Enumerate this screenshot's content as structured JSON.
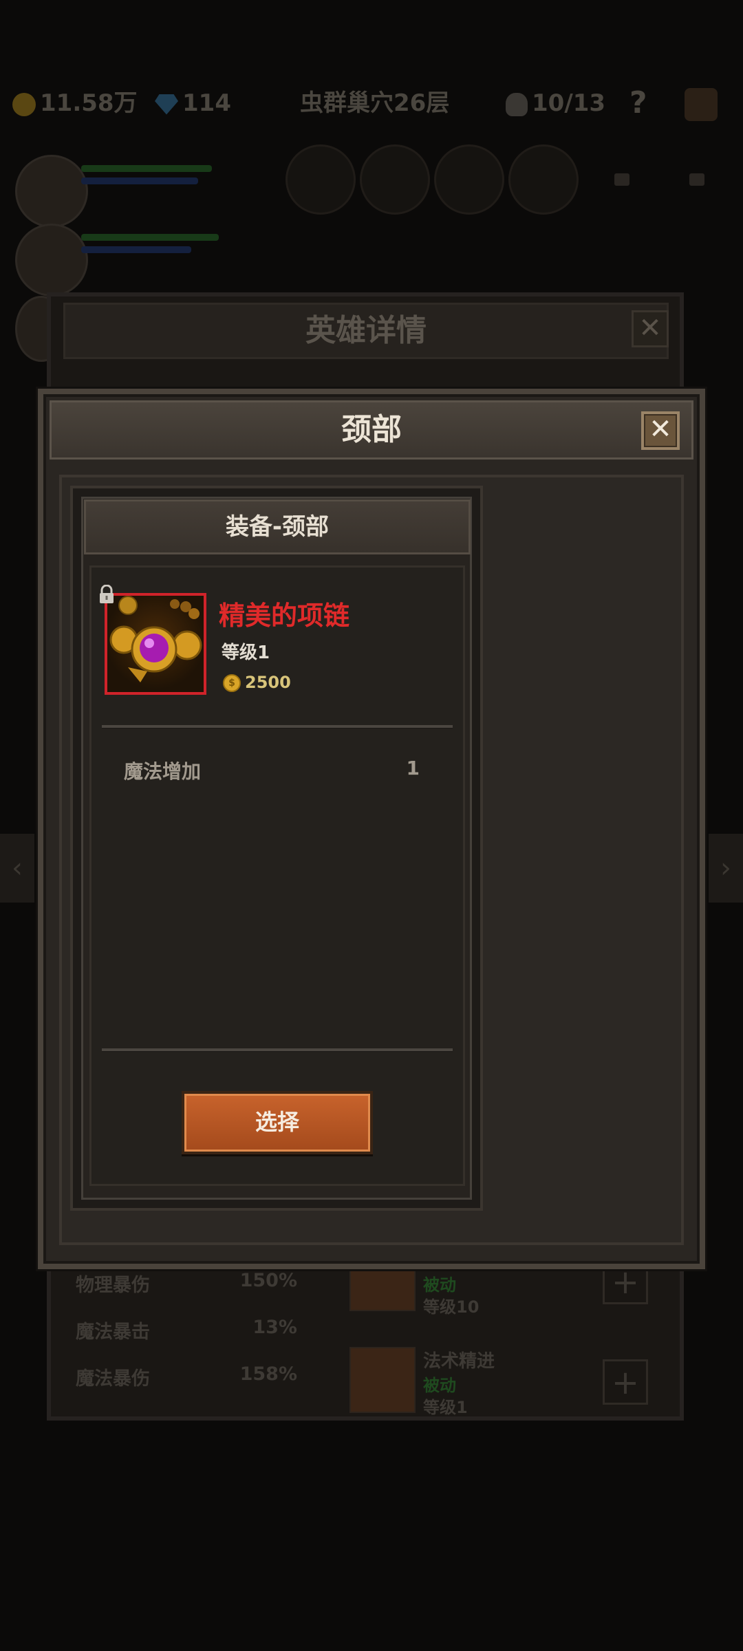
{
  "background": {
    "top_bar": {
      "gold": "11.58万",
      "gems": "114",
      "location": "虫群巢穴26层",
      "skull_count": "10/13",
      "help": "?"
    },
    "hero_details_panel": {
      "title": "英雄详情",
      "close_glyph": "✕",
      "stats": [
        {
          "label": "物理暴伤",
          "value": "150%"
        },
        {
          "label": "魔法暴击",
          "value": "13%"
        },
        {
          "label": "魔法暴伤",
          "value": "158%"
        }
      ],
      "skills": [
        {
          "name": "",
          "type": "被动",
          "level": "等级10"
        },
        {
          "name": "法术精进",
          "type": "被动",
          "level": "等级1"
        }
      ],
      "plus_glyph": "+"
    },
    "nav": {
      "left_glyph": "‹",
      "right_glyph": "›"
    }
  },
  "modal": {
    "title": "颈部",
    "close_glyph": "✕",
    "card": {
      "header": "装备-颈部",
      "item": {
        "name": "精美的项链",
        "level": "等级1",
        "price": "2500",
        "coin_glyph": "$",
        "icon": "necklace-icon",
        "rarity_color": "#d0232a"
      },
      "stats": [
        {
          "label": "魔法增加",
          "value": "1"
        }
      ],
      "select_label": "选择"
    }
  }
}
